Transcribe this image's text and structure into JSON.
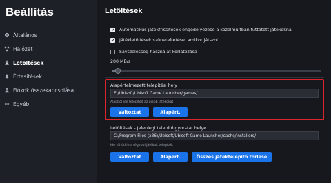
{
  "sidebar": {
    "title": "Beállítás",
    "items": [
      {
        "label": "Általános",
        "icon": "gear-icon",
        "active": false
      },
      {
        "label": "Hálózat",
        "icon": "network-icon",
        "active": false
      },
      {
        "label": "Letöltések",
        "icon": "download-icon",
        "active": true
      },
      {
        "label": "Értesítések",
        "icon": "bell-icon",
        "active": false
      },
      {
        "label": "Fiókok összekapcsolása",
        "icon": "link-icon",
        "active": false
      },
      {
        "label": "Egyéb",
        "icon": "more-icon",
        "active": false
      }
    ]
  },
  "main": {
    "title": "Letöltések",
    "options": [
      {
        "label": "Automatikus játékfrissítések engedélyezése a közelmúltban futtatott játékoknál",
        "checked": true
      },
      {
        "label": "Játékletöltések szüneteltetése, amikor játszol",
        "checked": true
      },
      {
        "label": "Sávszélesség-használat korlátozása",
        "checked": false
      }
    ],
    "speed_limit": {
      "label": "200 MB/s",
      "value_fraction": 0.03
    },
    "default_location": {
      "label": "Alapértelmezett telepítési hely",
      "path": "E:/Ubisoft/Ubisoft Game Launcher/games/",
      "hint": "Alapból ide telepíted az újabb játékokat",
      "change_label": "Változtat",
      "default_label": "Alapért."
    },
    "cache_location": {
      "label": "Letöltések - Jelenlegi telepítő gyorstár helye",
      "path": "C:/Program Files (x86)/Ubisoft/Ubisoft Game Launcher/cache/installers/",
      "hint": "Ide töltöd le a régebbi játékok telepítőit",
      "change_label": "Változtat",
      "default_label": "Alapért.",
      "clear_label": "Összes játéktelepítő törlése"
    }
  },
  "colors": {
    "accent": "#1a73e8",
    "highlight": "#d9252b",
    "background": "#16181d",
    "sidebar": "#1d2026"
  }
}
